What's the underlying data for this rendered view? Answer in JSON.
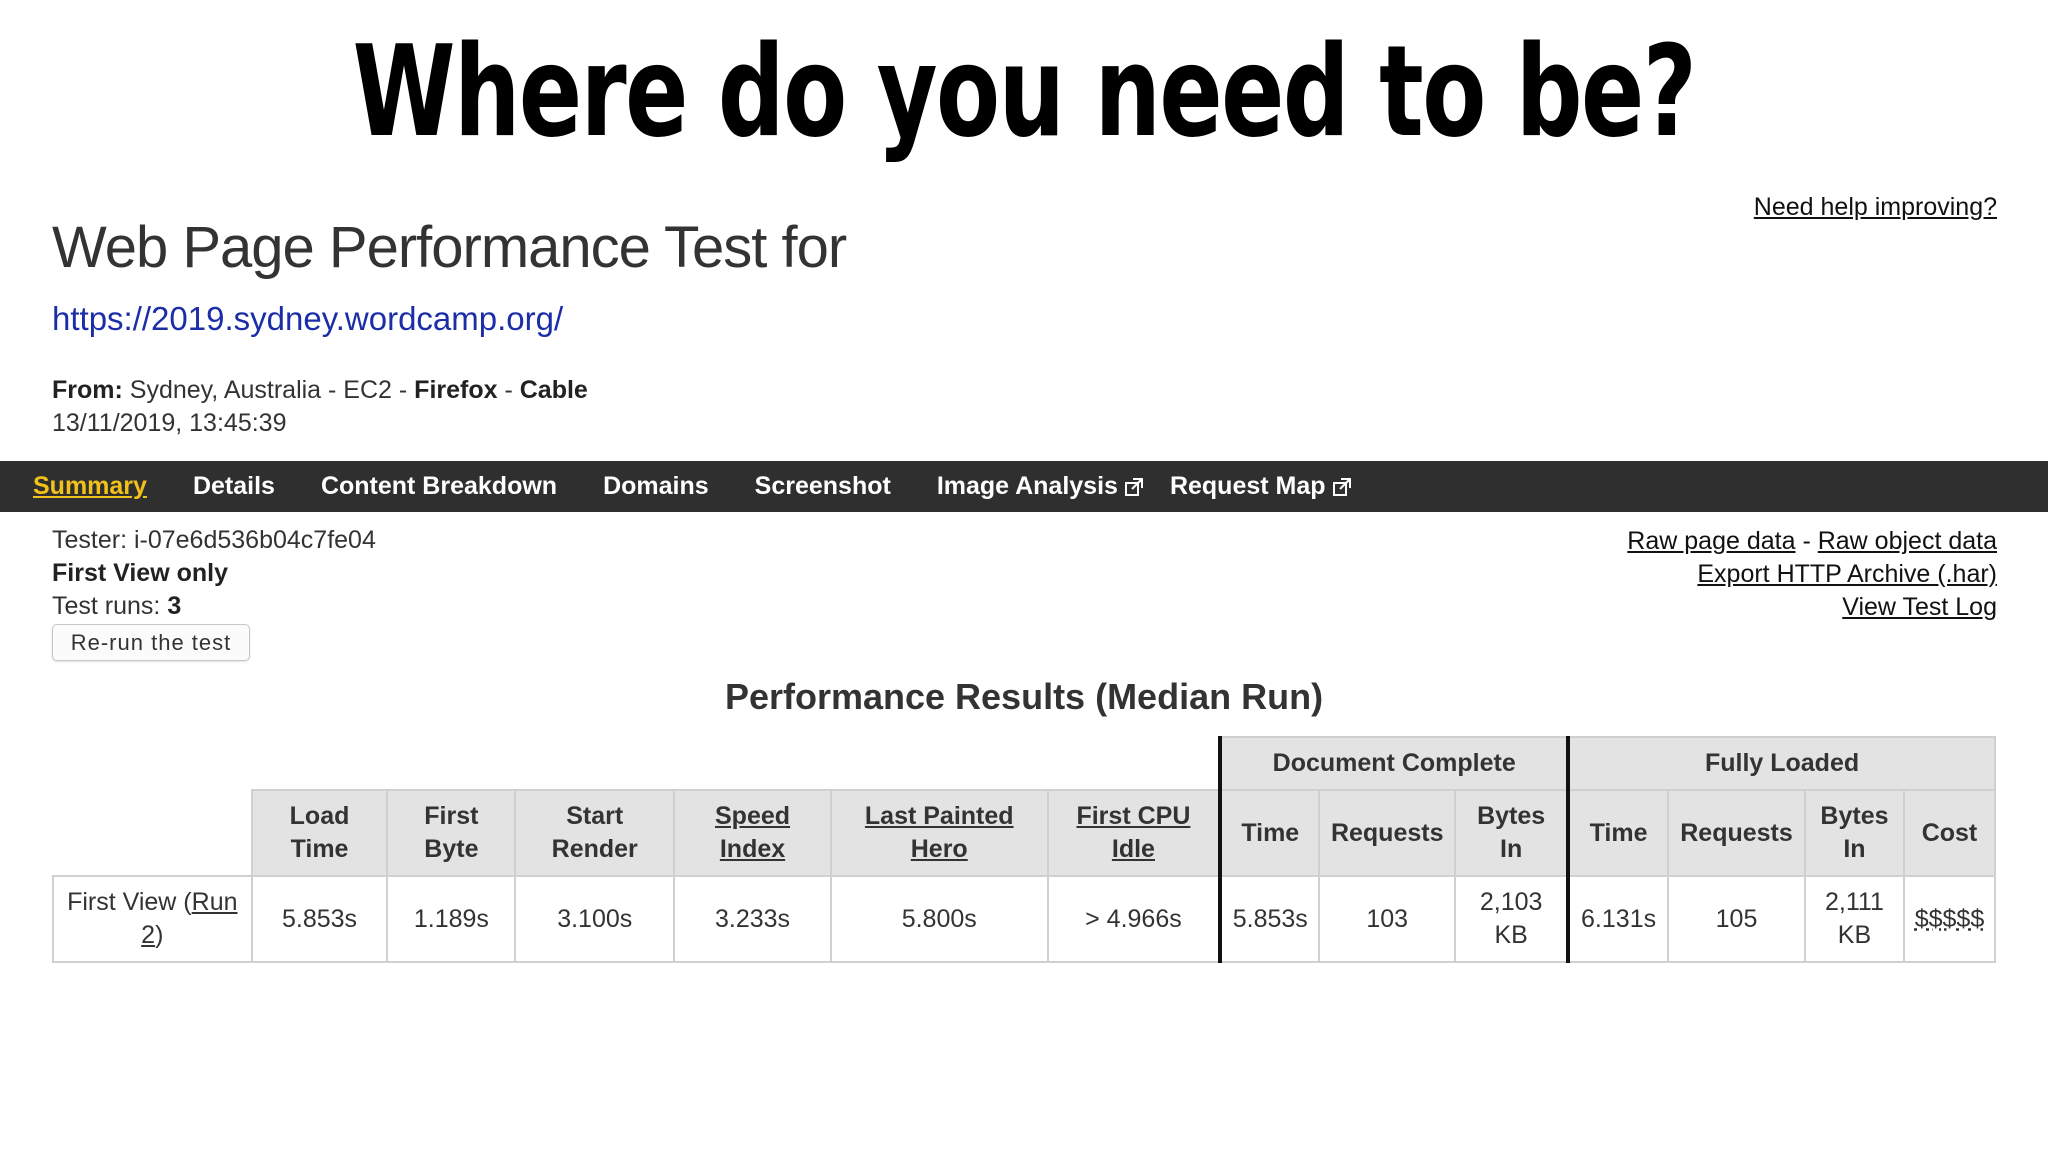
{
  "slide": {
    "title": "Where do you need to be?"
  },
  "header": {
    "help_link": "Need help improving?",
    "heading": "Web Page Performance Test for",
    "url": "https://2019.sydney.wordcamp.org/",
    "from_label": "From:",
    "from_location": "Sydney, Australia - EC2 -",
    "browser": "Firefox",
    "connection": "Cable",
    "datetime": "13/11/2019, 13:45:39"
  },
  "nav": {
    "items": [
      {
        "label": "Summary",
        "active": true,
        "external": false
      },
      {
        "label": "Details",
        "active": false,
        "external": false
      },
      {
        "label": "Content Breakdown",
        "active": false,
        "external": false
      },
      {
        "label": "Domains",
        "active": false,
        "external": false
      },
      {
        "label": "Screenshot",
        "active": false,
        "external": false
      },
      {
        "label": "Image Analysis",
        "active": false,
        "external": true
      },
      {
        "label": "Request Map",
        "active": false,
        "external": true
      }
    ]
  },
  "info": {
    "tester": "Tester: i-07e6d536b04c7fe04",
    "first_view_only": "First View only",
    "test_runs_label": "Test runs:",
    "test_runs_value": "3",
    "rerun_button": "Re-run the test"
  },
  "side_links": {
    "raw_page_data": "Raw page data",
    "separator": "-",
    "raw_object_data": "Raw object data",
    "export_har": "Export HTTP Archive (.har)",
    "view_test_log": "View Test Log"
  },
  "results": {
    "heading": "Performance Results (Median Run)",
    "groups": {
      "document_complete": "Document Complete",
      "fully_loaded": "Fully Loaded"
    },
    "headers": {
      "load_time": [
        "Load",
        "Time"
      ],
      "first_byte": [
        "First",
        "Byte"
      ],
      "start_render": [
        "Start",
        "Render"
      ],
      "speed_index": [
        "Speed",
        "Index"
      ],
      "last_painted_hero": [
        "Last Painted",
        "Hero"
      ],
      "first_cpu_idle": [
        "First CPU",
        "Idle"
      ],
      "dc_time": "Time",
      "dc_requests": "Requests",
      "dc_bytes_in": [
        "Bytes",
        "In"
      ],
      "fl_time": "Time",
      "fl_requests": "Requests",
      "fl_bytes_in": [
        "Bytes",
        "In"
      ],
      "cost": "Cost"
    },
    "row": {
      "label_prefix": "First View (",
      "run_link": [
        "Run",
        "2"
      ],
      "label_suffix": ")",
      "load_time": "5.853s",
      "first_byte": "1.189s",
      "start_render": "3.100s",
      "speed_index": "3.233s",
      "last_painted_hero": "5.800s",
      "first_cpu_idle": "> 4.966s",
      "dc_time": "5.853s",
      "dc_requests": "103",
      "dc_bytes_in": [
        "2,103",
        "KB"
      ],
      "fl_time": "6.131s",
      "fl_requests": "105",
      "fl_bytes_in": [
        "2,111",
        "KB"
      ],
      "cost": "$$$$$"
    }
  },
  "colors": {
    "nav_bg": "#2f2f2f",
    "nav_active": "#f2c21a",
    "link_blue": "#1b2ea8",
    "header_cell_bg": "#e3e3e3"
  }
}
